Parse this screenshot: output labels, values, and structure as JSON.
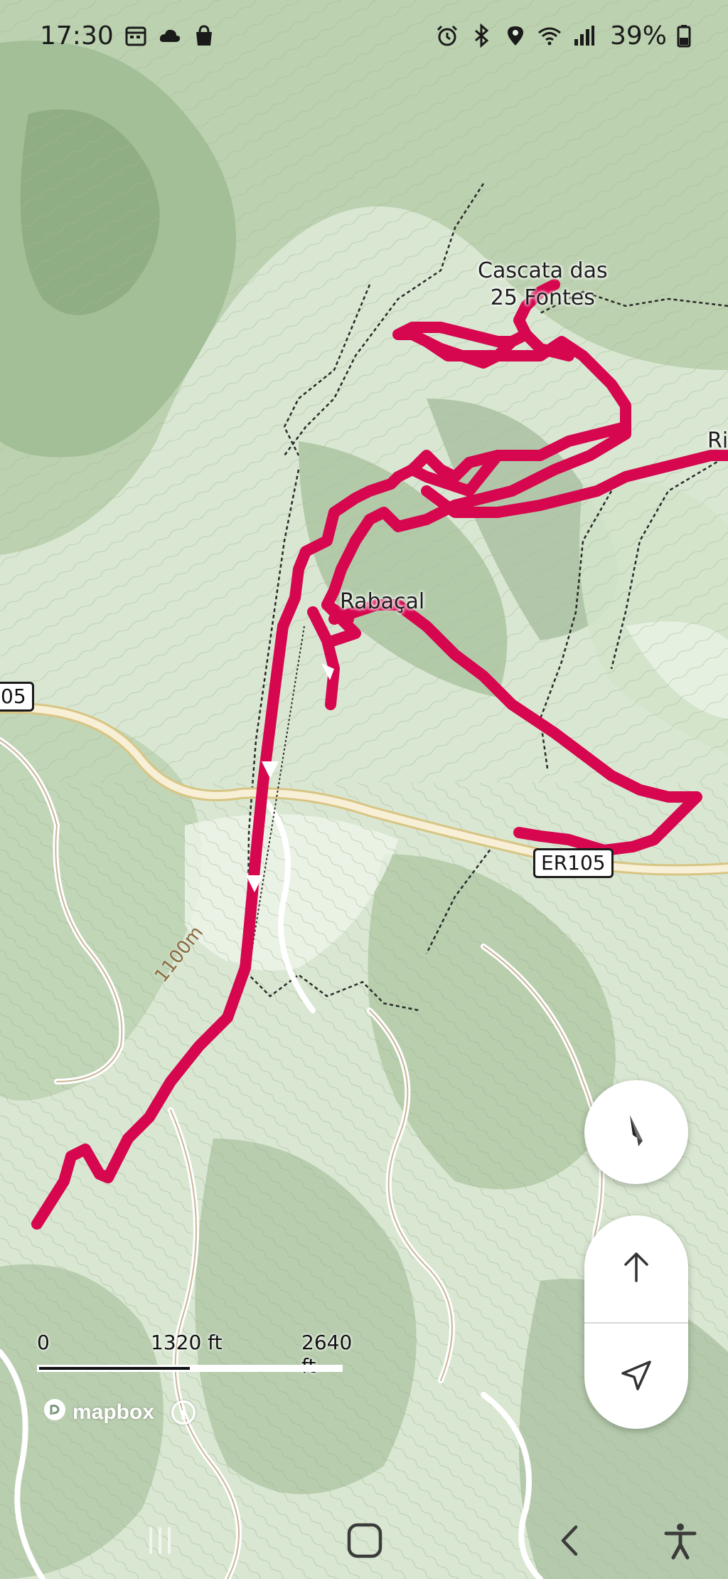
{
  "status_bar": {
    "time": "17:30",
    "left_icons": [
      "calendar-icon",
      "cloud-icon",
      "shopping-bag-icon"
    ],
    "right_icons": [
      "alarm-icon",
      "bluetooth-icon",
      "location-icon",
      "wifi-icon",
      "signal-icon"
    ],
    "battery": "39%"
  },
  "map": {
    "poi_label_line1": "Cascata das",
    "poi_label_line2": "25 Fontes",
    "place_label": "Rabaçal",
    "edge_label": "Ri",
    "road_shield_left": "05",
    "road_shield_right": "ER105",
    "contour_label": "1100m",
    "colors": {
      "track": "#d6064f",
      "terrain_light": "#e4eedf",
      "terrain_mid": "#b9cfb2",
      "terrain_dark": "#8fae87",
      "road_fill": "#f7f0d8",
      "road_edge": "#d9c88a"
    }
  },
  "scale_bar": {
    "start": "0",
    "mid": "1320 ft",
    "end": "2640 ft"
  },
  "attribution": {
    "brand": "mapbox",
    "logo_icon": "mapbox-logo-icon",
    "info_icon": "info-icon"
  },
  "controls": {
    "compass_icon": "compass-needle-icon",
    "north_up_icon": "arrow-up-icon",
    "locate_icon": "navigation-arrow-icon"
  },
  "system_nav": {
    "icons": [
      "recent-apps-icon",
      "home-icon",
      "back-icon",
      "accessibility-icon"
    ]
  }
}
